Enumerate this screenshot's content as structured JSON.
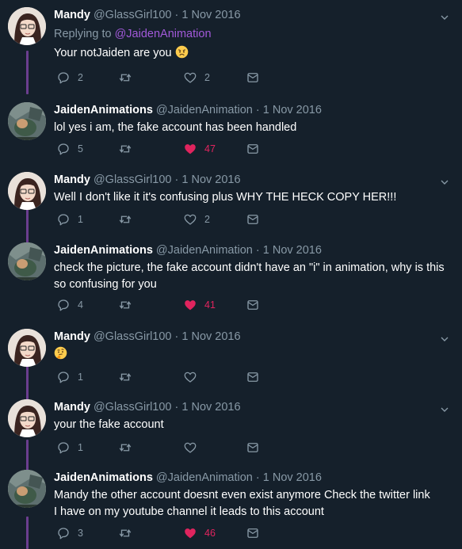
{
  "colors": {
    "background": "#15202b",
    "accent": "#a259d9",
    "like": "#e0245e",
    "muted": "#8899a6",
    "thread": "#6b3e8f"
  },
  "tweets": [
    {
      "name": "Mandy",
      "handle": "@GlassGirl100",
      "dot": "·",
      "date": "1 Nov 2016",
      "replying_prefix": "Replying to",
      "replying_to": "@JaidenAnimation",
      "text": "Your notJaiden are you",
      "emoji": "angry-face",
      "replies": "2",
      "retweets": "",
      "likes": "2",
      "liked": false
    },
    {
      "name": "JaidenAnimations",
      "handle": "@JaidenAnimation",
      "dot": "·",
      "date": "1 Nov 2016",
      "text": "lol yes i am, the fake account has been handled",
      "replies": "5",
      "retweets": "",
      "likes": "47",
      "liked": true
    },
    {
      "name": "Mandy",
      "handle": "@GlassGirl100",
      "dot": "·",
      "date": "1 Nov 2016",
      "text": "Well I don't like it it's confusing plus WHY THE HECK COPY HER!!!",
      "replies": "1",
      "retweets": "",
      "likes": "2",
      "liked": false
    },
    {
      "name": "JaidenAnimations",
      "handle": "@JaidenAnimation",
      "dot": "·",
      "date": "1 Nov 2016",
      "text": "check the picture, the fake account didn't have an \"i\" in animation, why is this so confusing for you",
      "replies": "4",
      "retweets": "",
      "likes": "41",
      "liked": true
    },
    {
      "name": "Mandy",
      "handle": "@GlassGirl100",
      "dot": "·",
      "date": "1 Nov 2016",
      "text": "",
      "emoji": "thinking-face",
      "replies": "1",
      "retweets": "",
      "likes": "",
      "liked": false
    },
    {
      "name": "Mandy",
      "handle": "@GlassGirl100",
      "dot": "·",
      "date": "1 Nov 2016",
      "text": "your the fake account",
      "replies": "1",
      "retweets": "",
      "likes": "",
      "liked": false
    },
    {
      "name": "JaidenAnimations",
      "handle": "@JaidenAnimation",
      "dot": "·",
      "date": "1 Nov 2016",
      "text": "Mandy the other account doesnt even exist anymore Check the twitter link I have on my youtube channel it leads to this account",
      "replies": "3",
      "retweets": "",
      "likes": "46",
      "liked": true
    }
  ]
}
